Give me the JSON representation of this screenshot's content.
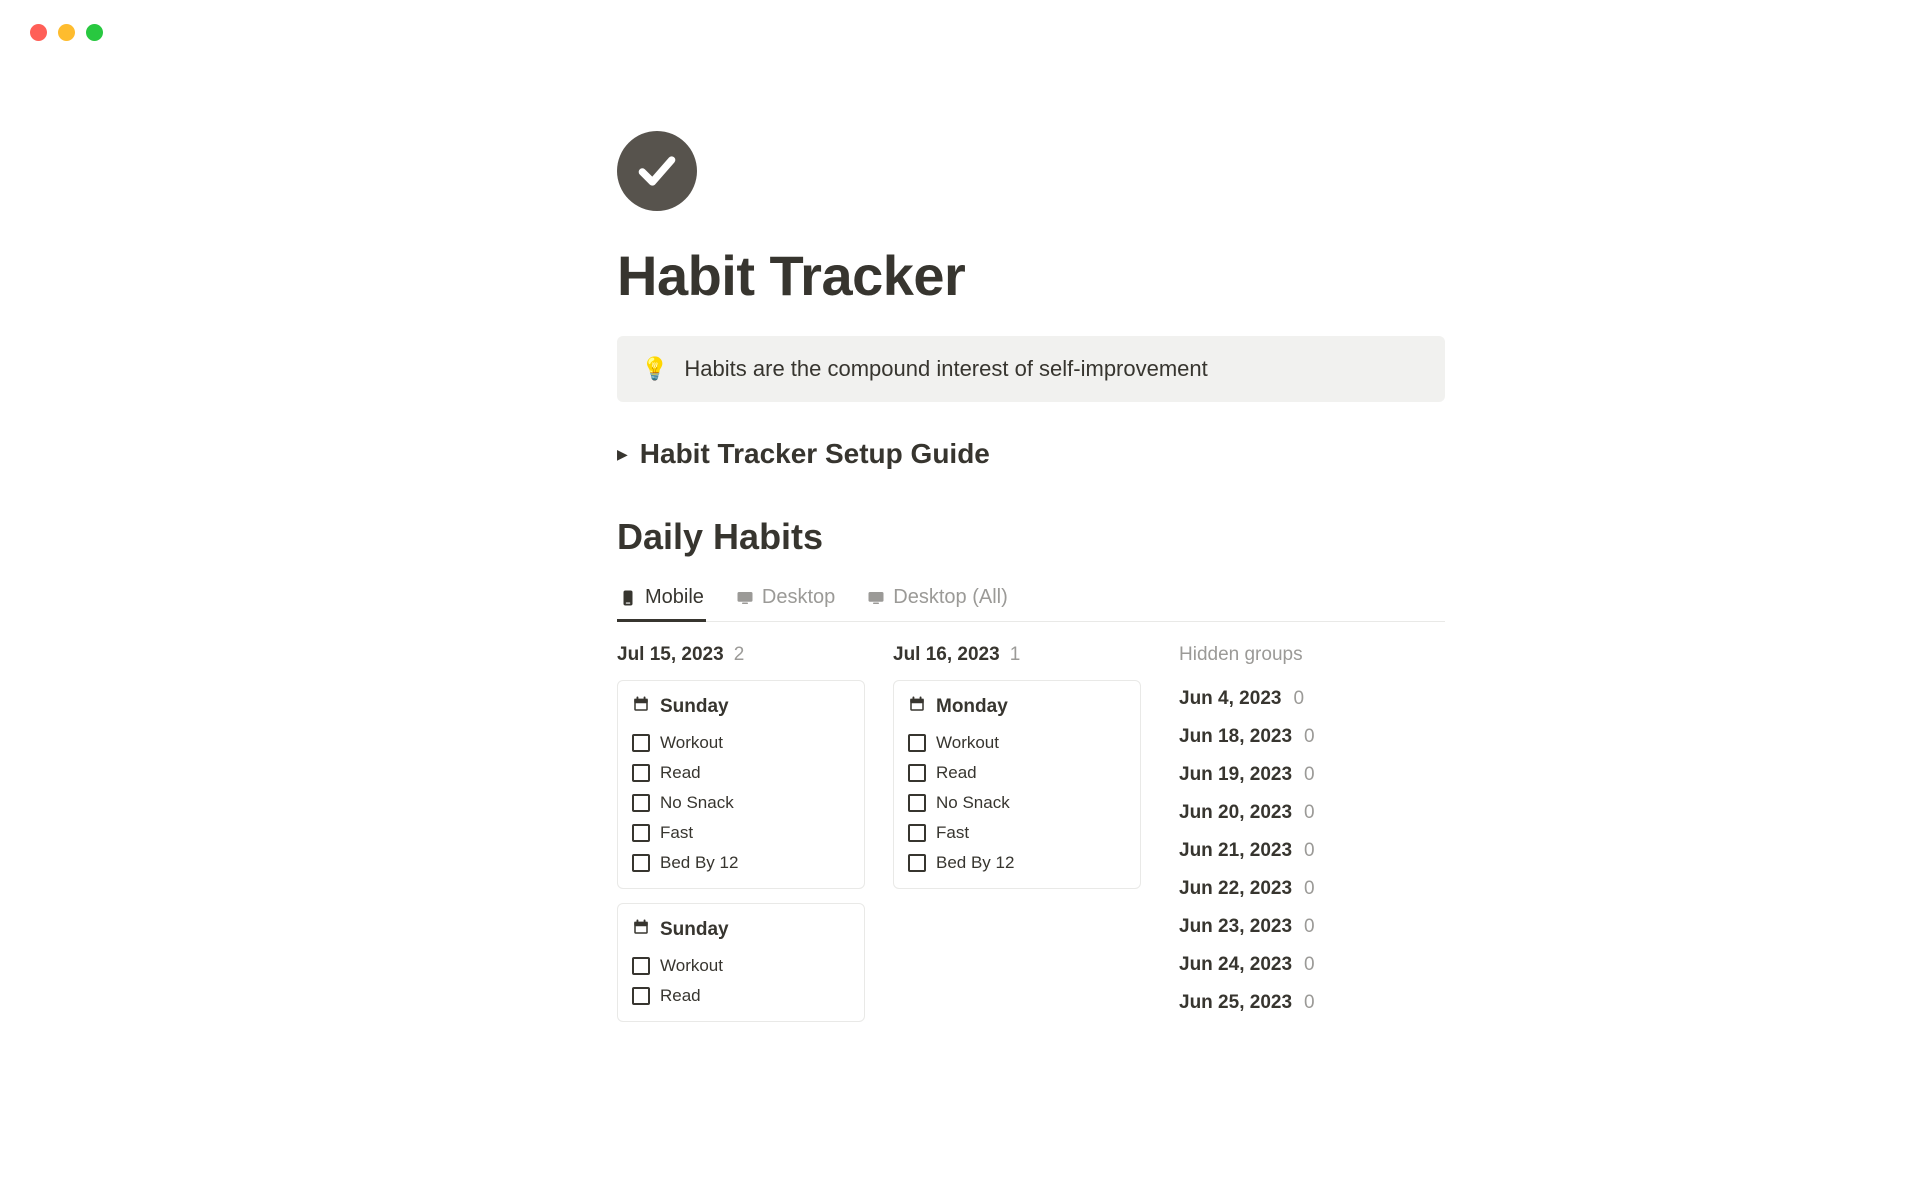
{
  "page": {
    "title": "Habit Tracker",
    "callout_icon": "💡",
    "callout_text": "Habits are the compound interest of self-improvement",
    "toggle_title": "Habit Tracker Setup Guide"
  },
  "daily": {
    "section_title": "Daily Habits",
    "tabs": [
      {
        "label": "Mobile",
        "active": true,
        "icon": "mobile"
      },
      {
        "label": "Desktop",
        "active": false,
        "icon": "desktop"
      },
      {
        "label": "Desktop (All)",
        "active": false,
        "icon": "desktop"
      }
    ],
    "columns": [
      {
        "date": "Jul 15, 2023",
        "count": "2",
        "cards": [
          {
            "title": "Sunday",
            "habits": [
              "Workout",
              "Read",
              "No Snack",
              "Fast",
              "Bed By 12"
            ]
          },
          {
            "title": "Sunday",
            "habits": [
              "Workout",
              "Read"
            ]
          }
        ]
      },
      {
        "date": "Jul 16, 2023",
        "count": "1",
        "cards": [
          {
            "title": "Monday",
            "habits": [
              "Workout",
              "Read",
              "No Snack",
              "Fast",
              "Bed By 12"
            ]
          }
        ]
      }
    ],
    "hidden": {
      "title": "Hidden groups",
      "items": [
        {
          "date": "Jun 4, 2023",
          "count": "0"
        },
        {
          "date": "Jun 18, 2023",
          "count": "0"
        },
        {
          "date": "Jun 19, 2023",
          "count": "0"
        },
        {
          "date": "Jun 20, 2023",
          "count": "0"
        },
        {
          "date": "Jun 21, 2023",
          "count": "0"
        },
        {
          "date": "Jun 22, 2023",
          "count": "0"
        },
        {
          "date": "Jun 23, 2023",
          "count": "0"
        },
        {
          "date": "Jun 24, 2023",
          "count": "0"
        },
        {
          "date": "Jun 25, 2023",
          "count": "0"
        }
      ]
    }
  }
}
